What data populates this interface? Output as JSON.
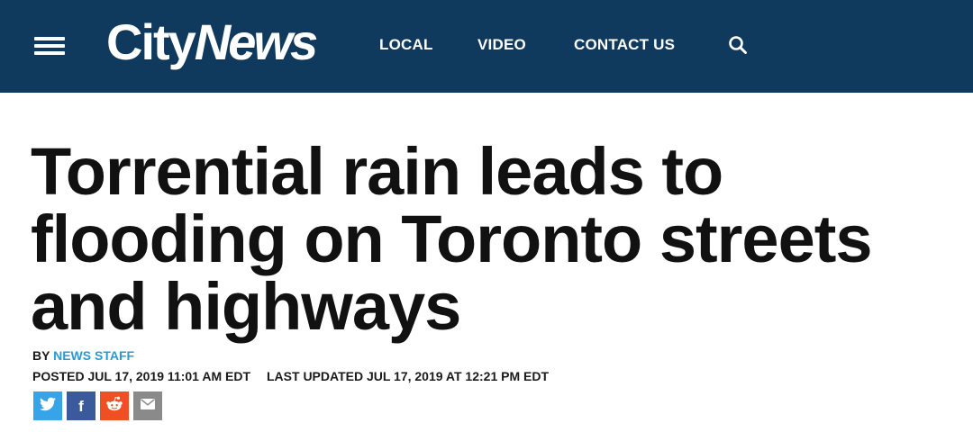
{
  "header": {
    "logo": {
      "city": "City",
      "news": "News"
    },
    "nav": [
      {
        "label": "LOCAL"
      },
      {
        "label": "VIDEO"
      },
      {
        "label": "CONTACT US"
      }
    ],
    "icons": {
      "menu": "hamburger-menu-icon",
      "search": "search-icon"
    }
  },
  "article": {
    "headline": "Torrential rain leads to flooding on Toronto streets and highways",
    "byline": {
      "prefix": "BY",
      "author": "NEWS STAFF"
    },
    "posted": "POSTED JUL 17, 2019 11:01 AM EDT",
    "updated": "LAST UPDATED JUL 17, 2019 AT 12:21 PM EDT"
  },
  "share": {
    "twitter": {
      "icon": "twitter-icon",
      "color": "#37a3e8"
    },
    "facebook": {
      "icon": "facebook-icon",
      "color": "#3b5a9c",
      "glyph": "f"
    },
    "reddit": {
      "icon": "reddit-icon",
      "color": "#f04e23"
    },
    "email": {
      "icon": "email-icon",
      "color": "#8a8a8a"
    }
  },
  "colors": {
    "header_bg": "#0f3a5e",
    "link": "#2a9ad1",
    "text": "#111111"
  }
}
